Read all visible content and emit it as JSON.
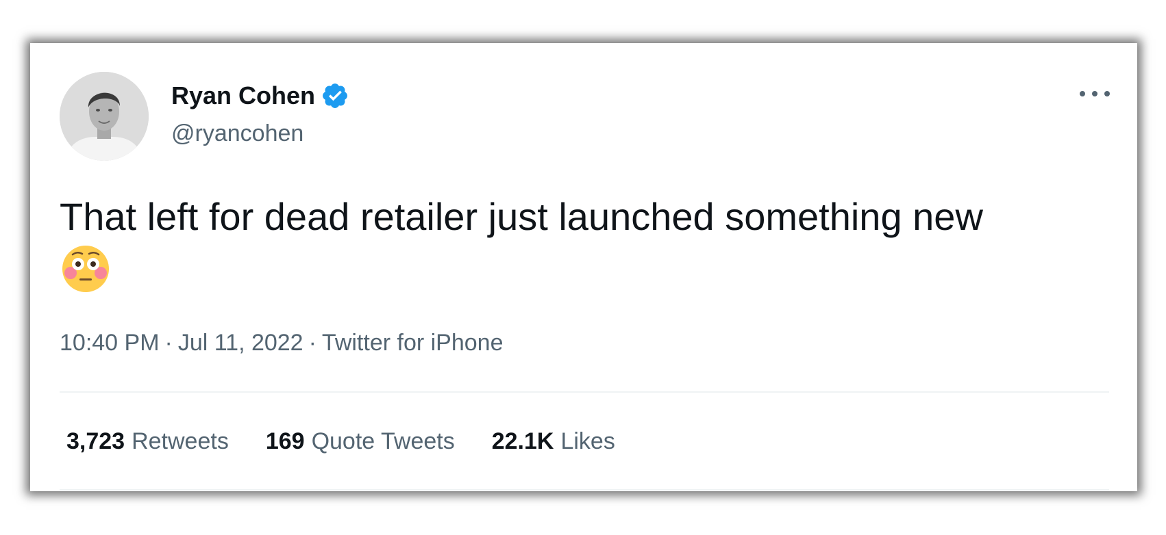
{
  "tweet": {
    "author": {
      "display_name": "Ryan Cohen",
      "handle": "@ryancohen",
      "verified": true,
      "avatar": "avatar-photo-icon"
    },
    "text": "That left for dead retailer just launched something new",
    "emoji": "flushed-face-icon",
    "time": "10:40 PM",
    "date": "Jul 11, 2022",
    "source": "Twitter for iPhone",
    "separator": "·",
    "stats": [
      {
        "count": "3,723",
        "label": "Retweets"
      },
      {
        "count": "169",
        "label": "Quote Tweets"
      },
      {
        "count": "22.1K",
        "label": "Likes"
      }
    ]
  },
  "colors": {
    "text_primary": "#0f1419",
    "text_secondary": "#536471",
    "verified_blue": "#1d9bf0",
    "divider": "#eff3f4"
  },
  "icons": {
    "more": "more-options-icon",
    "verified": "verified-badge-icon"
  }
}
